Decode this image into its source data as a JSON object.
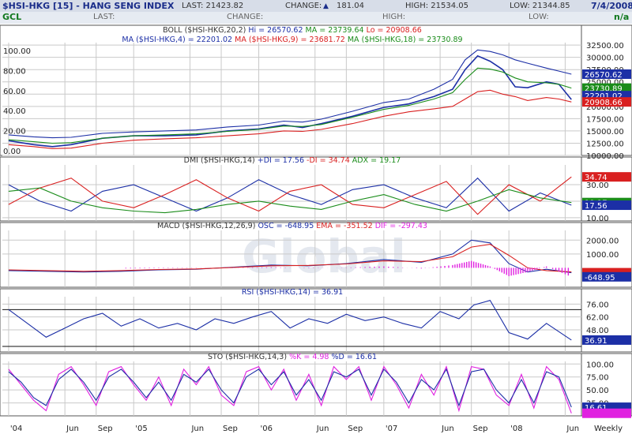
{
  "header": {
    "title": "$HSI-HKG [15] - HANG SENG INDEX",
    "last": "LAST: 21423.82",
    "change_label": "CHANGE:",
    "change_value": "181.04",
    "high": "HIGH: 21534.05",
    "low": "LOW: 21344.85",
    "date": "7/4/2008"
  },
  "header2": {
    "symbol": "GCL",
    "last_label": "LAST:",
    "change_label": "CHANGE:",
    "high_label": "HIGH:",
    "low_label": "LOW:",
    "na": "n/a"
  },
  "watermark": "Global",
  "colors": {
    "price": "#1c2fa6",
    "boll": "#1c2fa6",
    "ma4": "#1c2fa6",
    "ma9": "#d92020",
    "ma18": "#1a8c1a",
    "pdi": "#1c2fa6",
    "mdi": "#d92020",
    "adx": "#1a8c1a",
    "macd": "#1c2fa6",
    "ema": "#d92020",
    "dif": "#e020e0",
    "rsi": "#1c2fa6",
    "stok": "#e020e0",
    "stod": "#1c2fa6",
    "grid": "#c9c9c9"
  },
  "chart_data": [
    {
      "type": "line",
      "panel": "price",
      "title_parts": [
        {
          "text": "BOLL ($HSI-HKG,20,2) ",
          "color": "#333333"
        },
        {
          "text": "Hi = 26570.62 ",
          "color": "#1c2fa6"
        },
        {
          "text": "MA = 23739.64 ",
          "color": "#1a8c1a"
        },
        {
          "text": "Lo = 20908.66",
          "color": "#d92020"
        }
      ],
      "title_parts2": [
        {
          "text": "MA ($HSI-HKG,4) = 22201.02 ",
          "color": "#1c2fa6"
        },
        {
          "text": "MA ($HSI-HKG,9) = 23681.72 ",
          "color": "#d92020"
        },
        {
          "text": "MA ($HSI-HKG,18) = 23730.89",
          "color": "#1a8c1a"
        }
      ],
      "left_ticks": [
        "100.00",
        "80.00",
        "60.00",
        "40.00",
        "20.00",
        "0.00"
      ],
      "right_ticks": [
        "32500.00",
        "30000.00",
        "27500.00",
        "25000.00",
        "22500.00",
        "20000.00",
        "17500.00",
        "15000.00",
        "12500.00",
        "10000.00"
      ],
      "ylim": [
        10000,
        33000
      ],
      "x": [
        2004.0,
        2004.2,
        2004.35,
        2004.5,
        2004.75,
        2005.0,
        2005.25,
        2005.5,
        2005.75,
        2006.0,
        2006.2,
        2006.35,
        2006.5,
        2006.75,
        2007.0,
        2007.2,
        2007.4,
        2007.55,
        2007.65,
        2007.75,
        2007.85,
        2007.95,
        2008.05,
        2008.15,
        2008.3,
        2008.4,
        2008.5
      ],
      "series": [
        {
          "name": "HSI",
          "values": [
            13000,
            12200,
            11800,
            12200,
            13500,
            14000,
            14000,
            14200,
            15000,
            15400,
            16200,
            15700,
            16500,
            18000,
            19800,
            20500,
            22000,
            23500,
            27500,
            30300,
            29200,
            27500,
            24000,
            23800,
            25000,
            24500,
            21400
          ]
        },
        {
          "name": "BOLL Hi",
          "values": [
            14200,
            13800,
            13600,
            13700,
            14500,
            14800,
            15000,
            15200,
            15800,
            16200,
            17000,
            16800,
            17400,
            19000,
            20800,
            21500,
            23500,
            25500,
            29500,
            31500,
            31200,
            30500,
            29500,
            28800,
            27800,
            27200,
            26570
          ]
        },
        {
          "name": "BOLL MA",
          "values": [
            13200,
            12800,
            12500,
            12600,
            13500,
            14000,
            14200,
            14400,
            14900,
            15300,
            16000,
            15900,
            16300,
            17800,
            19400,
            20200,
            21500,
            22800,
            25500,
            27800,
            27600,
            27000,
            25800,
            25000,
            24800,
            24500,
            23739
          ]
        },
        {
          "name": "BOLL Lo",
          "values": [
            12200,
            11800,
            11400,
            11500,
            12500,
            13100,
            13400,
            13600,
            14000,
            14400,
            15000,
            14900,
            15300,
            16500,
            18000,
            18900,
            19500,
            20000,
            21500,
            23000,
            23300,
            22500,
            22000,
            21200,
            21800,
            21500,
            20908
          ]
        }
      ]
    },
    {
      "type": "line",
      "panel": "dmi",
      "title_parts": [
        {
          "text": "DMI ($HSI-HKG,14) ",
          "color": "#333333"
        },
        {
          "text": "+DI = 17.56 ",
          "color": "#1c2fa6"
        },
        {
          "text": "-DI = 34.74 ",
          "color": "#d92020"
        },
        {
          "text": "ADX = 19.17",
          "color": "#1a8c1a"
        }
      ],
      "right_ticks": [
        "30.00",
        "20.00",
        "10.00"
      ],
      "ylim": [
        8,
        42
      ],
      "markers": [
        {
          "value": 34.74,
          "label": "34.74",
          "color": "#d92020"
        },
        {
          "value": 19.17,
          "label": "19.17",
          "color": "#1a8c1a"
        },
        {
          "value": 17.56,
          "label": "17.56",
          "color": "#1c2fa6"
        }
      ],
      "x": [
        2004.0,
        2004.25,
        2004.5,
        2004.75,
        2005.0,
        2005.25,
        2005.5,
        2005.75,
        2006.0,
        2006.25,
        2006.5,
        2006.75,
        2007.0,
        2007.25,
        2007.5,
        2007.75,
        2008.0,
        2008.25,
        2008.5
      ],
      "series": [
        {
          "name": "+DI",
          "values": [
            30,
            20,
            14,
            26,
            30,
            22,
            14,
            22,
            33,
            24,
            18,
            27,
            30,
            22,
            16,
            34,
            14,
            25,
            17.56
          ]
        },
        {
          "name": "-DI",
          "values": [
            18,
            28,
            34,
            20,
            16,
            24,
            33,
            22,
            14,
            26,
            30,
            18,
            16,
            24,
            32,
            12,
            30,
            20,
            34.74
          ]
        },
        {
          "name": "ADX",
          "values": [
            26,
            28,
            20,
            16,
            14,
            13,
            15,
            18,
            20,
            17,
            15,
            20,
            24,
            18,
            14,
            20,
            27,
            22,
            19.17
          ]
        }
      ]
    },
    {
      "type": "line",
      "panel": "macd",
      "title_parts": [
        {
          "text": "MACD ($HSI-HKG,12,26,9) ",
          "color": "#333333"
        },
        {
          "text": "OSC = -648.95 ",
          "color": "#1c2fa6"
        },
        {
          "text": "EMA = -351.52 ",
          "color": "#d92020"
        },
        {
          "text": "DIF = -297.43",
          "color": "#e020e0"
        }
      ],
      "right_ticks": [
        "2000.00",
        "1000.00"
      ],
      "ylim": [
        -1400,
        2700
      ],
      "markers": [
        {
          "value": -351.52,
          "label": "",
          "color": "#d92020"
        },
        {
          "value": -648.95,
          "label": "-648.95",
          "color": "#1c2fa6"
        }
      ],
      "x": [
        2004.0,
        2004.3,
        2004.6,
        2004.9,
        2005.2,
        2005.5,
        2005.8,
        2006.1,
        2006.4,
        2006.7,
        2007.0,
        2007.3,
        2007.55,
        2007.7,
        2007.85,
        2008.0,
        2008.15,
        2008.3,
        2008.5
      ],
      "series": [
        {
          "name": "MACD",
          "values": [
            -200,
            -250,
            -300,
            -250,
            -150,
            -100,
            50,
            200,
            150,
            300,
            600,
            400,
            1000,
            2000,
            1800,
            300,
            -300,
            -100,
            -351.52
          ]
        },
        {
          "name": "EMA",
          "values": [
            -150,
            -200,
            -250,
            -200,
            -120,
            -80,
            30,
            150,
            180,
            280,
            500,
            450,
            800,
            1500,
            1700,
            900,
            0,
            -200,
            -297.43
          ]
        },
        {
          "name": "DIF",
          "values": [
            -50,
            -50,
            -50,
            -50,
            -30,
            -20,
            20,
            50,
            -30,
            20,
            100,
            -50,
            200,
            500,
            100,
            -600,
            -300,
            100,
            -648.95
          ]
        }
      ]
    },
    {
      "type": "line",
      "panel": "rsi",
      "title_parts": [
        {
          "text": "RSI ($HSI-HKG,14) = 36.91",
          "color": "#1c2fa6"
        }
      ],
      "right_ticks": [
        "76.00",
        "62.00",
        "48.00"
      ],
      "ylim": [
        24,
        84
      ],
      "reference_lines": [
        70,
        30
      ],
      "markers": [
        {
          "value": 36.91,
          "label": "36.91",
          "color": "#1c2fa6"
        }
      ],
      "x": [
        2004.0,
        2004.15,
        2004.3,
        2004.45,
        2004.6,
        2004.75,
        2004.9,
        2005.05,
        2005.2,
        2005.35,
        2005.5,
        2005.65,
        2005.8,
        2005.95,
        2006.1,
        2006.25,
        2006.4,
        2006.55,
        2006.7,
        2006.85,
        2007.0,
        2007.15,
        2007.3,
        2007.45,
        2007.6,
        2007.72,
        2007.85,
        2008.0,
        2008.15,
        2008.3,
        2008.5
      ],
      "series": [
        {
          "name": "RSI",
          "values": [
            70,
            55,
            40,
            50,
            60,
            66,
            52,
            60,
            50,
            55,
            48,
            60,
            55,
            62,
            68,
            50,
            60,
            55,
            65,
            58,
            62,
            55,
            50,
            68,
            60,
            75,
            80,
            45,
            38,
            55,
            36.91
          ]
        }
      ]
    },
    {
      "type": "line",
      "panel": "sto",
      "title_parts": [
        {
          "text": "STO ($HSI-HKG,14,3) ",
          "color": "#333333"
        },
        {
          "text": "%K = 4.98 ",
          "color": "#e020e0"
        },
        {
          "text": "%D = 16.61",
          "color": "#1c2fa6"
        }
      ],
      "right_ticks": [
        "100.00",
        "75.00",
        "50.00",
        "25.00"
      ],
      "ylim": [
        0,
        105
      ],
      "markers": [
        {
          "value": 16.61,
          "label": "16.61",
          "color": "#1c2fa6"
        },
        {
          "value": 4.98,
          "label": "",
          "color": "#e020e0"
        }
      ],
      "x": [
        2004.0,
        2004.1,
        2004.2,
        2004.3,
        2004.4,
        2004.5,
        2004.6,
        2004.7,
        2004.8,
        2004.9,
        2005.0,
        2005.1,
        2005.2,
        2005.3,
        2005.4,
        2005.5,
        2005.6,
        2005.7,
        2005.8,
        2005.9,
        2006.0,
        2006.1,
        2006.2,
        2006.3,
        2006.4,
        2006.5,
        2006.6,
        2006.7,
        2006.8,
        2006.9,
        2007.0,
        2007.1,
        2007.2,
        2007.3,
        2007.4,
        2007.5,
        2007.6,
        2007.7,
        2007.8,
        2007.9,
        2008.0,
        2008.1,
        2008.2,
        2008.3,
        2008.4,
        2008.5
      ],
      "series": [
        {
          "name": "%K",
          "values": [
            90,
            60,
            30,
            10,
            80,
            95,
            60,
            20,
            85,
            95,
            60,
            30,
            75,
            20,
            90,
            60,
            95,
            40,
            20,
            85,
            95,
            50,
            90,
            30,
            80,
            20,
            95,
            70,
            95,
            30,
            95,
            60,
            15,
            80,
            40,
            95,
            10,
            95,
            90,
            40,
            20,
            80,
            15,
            95,
            70,
            4.98
          ]
        },
        {
          "name": "%D",
          "values": [
            85,
            65,
            35,
            20,
            70,
            90,
            65,
            30,
            75,
            90,
            65,
            35,
            65,
            30,
            80,
            65,
            90,
            50,
            25,
            75,
            90,
            60,
            85,
            40,
            70,
            30,
            85,
            75,
            90,
            40,
            90,
            65,
            25,
            70,
            50,
            90,
            20,
            85,
            90,
            50,
            25,
            70,
            25,
            85,
            75,
            16.61
          ]
        }
      ]
    }
  ],
  "x_axis": {
    "labels": [
      {
        "x": 2004.0,
        "text": "'04"
      },
      {
        "x": 2004.45,
        "text": "Jun"
      },
      {
        "x": 2004.7,
        "text": "Sep"
      },
      {
        "x": 2005.0,
        "text": "'05"
      },
      {
        "x": 2005.45,
        "text": "Jun"
      },
      {
        "x": 2005.7,
        "text": "Sep"
      },
      {
        "x": 2006.0,
        "text": "'06"
      },
      {
        "x": 2006.45,
        "text": "Jun"
      },
      {
        "x": 2006.7,
        "text": "Sep"
      },
      {
        "x": 2007.0,
        "text": "'07"
      },
      {
        "x": 2007.45,
        "text": "Jun"
      },
      {
        "x": 2007.7,
        "text": "Sep"
      },
      {
        "x": 2008.0,
        "text": "'08"
      },
      {
        "x": 2008.45,
        "text": "Jun"
      }
    ],
    "xlim": [
      2003.95,
      2008.58
    ],
    "period_label": "Weekly"
  }
}
